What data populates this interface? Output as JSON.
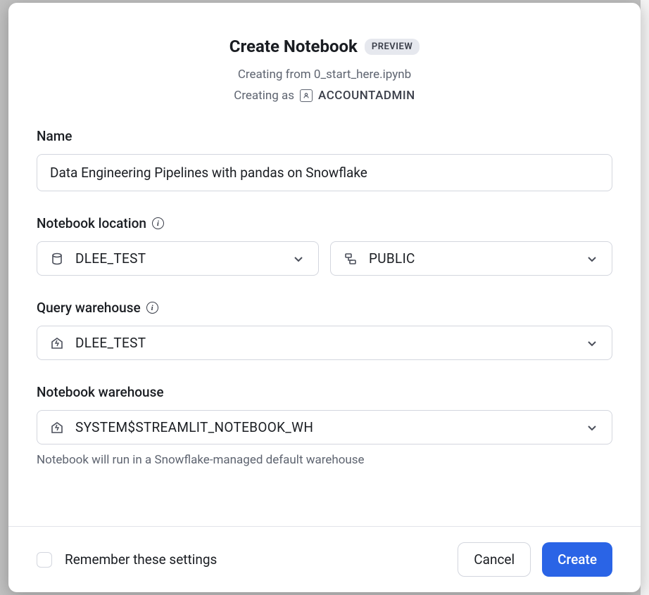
{
  "header": {
    "title": "Create Notebook",
    "badge": "PREVIEW",
    "creating_from_prefix": "Creating from ",
    "creating_from_file": "0_start_here.ipynb",
    "creating_as_prefix": "Creating as",
    "creating_as_role": "ACCOUNTADMIN"
  },
  "name": {
    "label": "Name",
    "value": "Data Engineering Pipelines with pandas on Snowflake"
  },
  "location": {
    "label": "Notebook location",
    "database": "DLEE_TEST",
    "schema": "PUBLIC"
  },
  "query_warehouse": {
    "label": "Query warehouse",
    "value": "DLEE_TEST"
  },
  "notebook_warehouse": {
    "label": "Notebook warehouse",
    "value": "SYSTEM$STREAMLIT_NOTEBOOK_WH",
    "helper": "Notebook will run in a Snowflake-managed default warehouse"
  },
  "footer": {
    "remember_label": "Remember these settings",
    "cancel": "Cancel",
    "create": "Create"
  }
}
